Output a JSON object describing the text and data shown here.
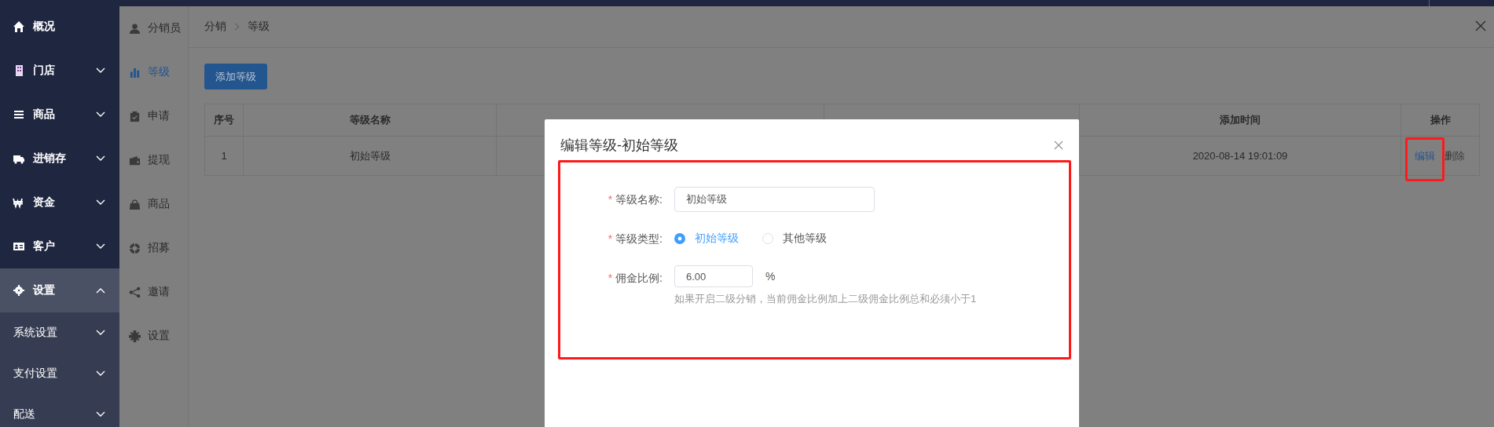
{
  "sidebar": {
    "items": [
      {
        "label": "概况",
        "kind": "link",
        "selected": false
      },
      {
        "label": "门店",
        "kind": "group",
        "selected": false,
        "expanded": false
      },
      {
        "label": "商品",
        "kind": "group",
        "selected": false,
        "expanded": false
      },
      {
        "label": "进销存",
        "kind": "group",
        "selected": false,
        "expanded": false
      },
      {
        "label": "资金",
        "kind": "group",
        "selected": false,
        "expanded": false
      },
      {
        "label": "客户",
        "kind": "group",
        "selected": false,
        "expanded": false
      },
      {
        "label": "设置",
        "kind": "group",
        "selected": true,
        "expanded": true,
        "children": [
          {
            "label": "系统设置",
            "expanded": false
          },
          {
            "label": "支付设置",
            "expanded": false
          },
          {
            "label": "配送",
            "expanded": false
          }
        ]
      }
    ]
  },
  "subnav": {
    "items": [
      {
        "label": "分销员",
        "selected": false
      },
      {
        "label": "等级",
        "selected": true
      },
      {
        "label": "申请",
        "selected": false
      },
      {
        "label": "提现",
        "selected": false
      },
      {
        "label": "商品",
        "selected": false
      },
      {
        "label": "招募",
        "selected": false
      },
      {
        "label": "邀请",
        "selected": false
      },
      {
        "label": "设置",
        "selected": false
      }
    ]
  },
  "breadcrumb": [
    "分销",
    "等级"
  ],
  "add_button": "添加等级",
  "table": {
    "columns": {
      "column_1": "序号",
      "column_2": "等级名称",
      "column_5": "添加时间",
      "column_6": "操作"
    },
    "rows": [
      {
        "column_1": "1",
        "column_2": "初始等级",
        "column_5": "2020-08-14 19:01:09",
        "actions": [
          {
            "label": "编辑",
            "kind": "edit"
          },
          {
            "label": "删除",
            "kind": "delete"
          }
        ]
      }
    ]
  },
  "dialog": {
    "title": "编辑等级-初始等级",
    "required_mark": "*",
    "fields": [
      {
        "kind": "text",
        "label": "等级名称:",
        "required": true,
        "value": "初始等级"
      },
      {
        "kind": "radio",
        "label": "等级类型:",
        "required": true,
        "options": [
          {
            "label": "初始等级",
            "selected": true
          },
          {
            "label": "其他等级",
            "selected": false
          }
        ]
      },
      {
        "kind": "number",
        "label": "佣金比例:",
        "required": true,
        "value": "6.00",
        "unit": "%",
        "hint": "如果开启二级分销，当前佣金比例加上二级佣金比例总和必须小于1"
      }
    ]
  }
}
